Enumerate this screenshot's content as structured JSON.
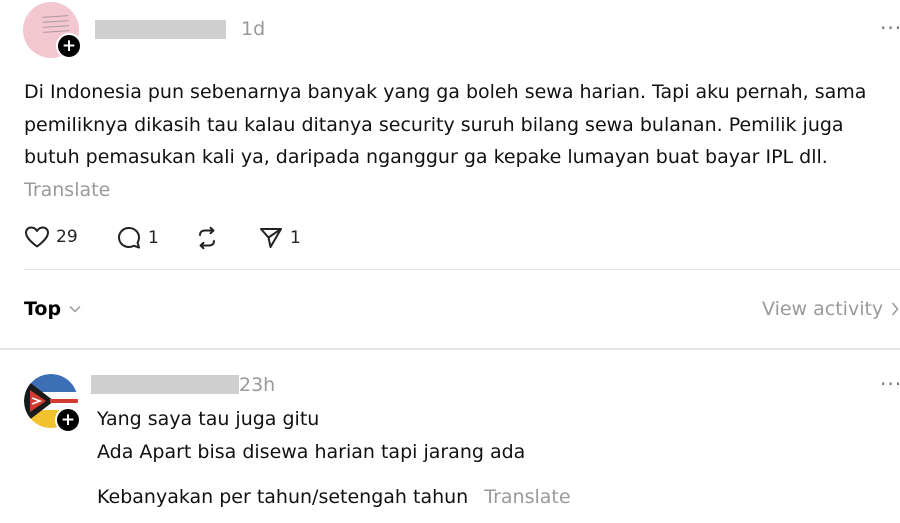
{
  "post": {
    "time": "1d",
    "more": "···",
    "text": "Di Indonesia pun sebenarnya banyak yang ga boleh sewa harian. Tapi aku pernah, sama pemiliknya dikasih tau kalau ditanya security suruh bilang sewa bulanan. Pemilik juga butuh pemasukan kali ya, daripada nganggur ga kepake lumayan buat bayar IPL dll.",
    "translate": "Translate",
    "actions": {
      "likes": "29",
      "replies": "1",
      "shares": "1"
    }
  },
  "sort": {
    "label": "Top",
    "view_activity": "View activity"
  },
  "reply": {
    "time": "23h",
    "more": "···",
    "lines": [
      "Yang saya tau juga gitu",
      "Ada Apart bisa disewa harian tapi jarang ada",
      "Kebanyakan per tahun/setengah tahun"
    ],
    "translate": "Translate"
  },
  "icons": {
    "follow": "+",
    "like": "heart-icon",
    "reply": "comment-icon",
    "repost": "repost-icon",
    "share": "send-icon",
    "chevron": "chevron-down-icon"
  },
  "colors": {
    "avatar_pink": "#f3c7cf",
    "muted_text": "#9a9a9a",
    "redaction": "#cfcfcf"
  }
}
